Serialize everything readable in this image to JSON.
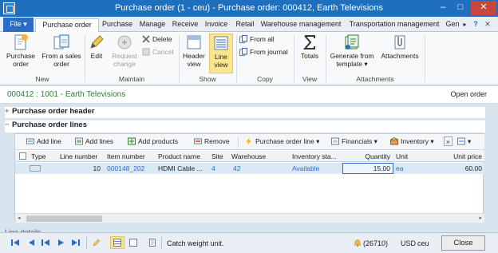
{
  "window": {
    "title": "Purchase order (1 - ceu) - Purchase order: 000412, Earth Televisions",
    "minimize": "–",
    "maximize": "□",
    "close": "✕"
  },
  "tabs": [
    "File",
    "Purchase order",
    "Purchase",
    "Manage",
    "Receive",
    "Invoice",
    "Retail",
    "Warehouse management",
    "Transportation management",
    "Gen",
    "?",
    "✕"
  ],
  "ribbon": {
    "new": {
      "purchase_order": "Purchase order",
      "from_sales_order": "From a sales order",
      "group": "New"
    },
    "maintain": {
      "edit": "Edit",
      "request_change": "Request change",
      "delete": "Delete",
      "cancel": "Cancel",
      "group": "Maintain"
    },
    "show": {
      "header_view": "Header view",
      "line_view": "Line view",
      "group": "Show"
    },
    "copy": {
      "from_all": "From all",
      "from_journal": "From journal",
      "group": "Copy"
    },
    "view": {
      "totals": "Totals",
      "group": "View"
    },
    "attachments": {
      "generate_from_template": "Generate from template",
      "attachments": "Attachments",
      "group": "Attachments"
    }
  },
  "record": {
    "title": "000412 : 1001 - Earth Televisions",
    "open_order": "Open order"
  },
  "sections": {
    "header": "Purchase order header",
    "lines": "Purchase order lines"
  },
  "grid_toolbar": {
    "add_line": "Add line",
    "add_lines": "Add lines",
    "add_products": "Add products",
    "remove": "Remove",
    "purchase_order_line": "Purchase order line",
    "financials": "Financials",
    "inventory": "Inventory",
    "more": "»"
  },
  "grid": {
    "columns": [
      "Type",
      "Line number",
      "Item number",
      "Product name",
      "Site",
      "Warehouse",
      "Inventory sta...",
      "Quantity",
      "Unit",
      "Unit price"
    ],
    "rows": [
      {
        "line_number": "10",
        "item_number": "000148_202",
        "product_name": "HDMI Cable ...",
        "site": "4",
        "warehouse": "42",
        "inventory_status": "Available",
        "quantity": "15.00",
        "unit": "ea",
        "unit_price": "60.00"
      }
    ]
  },
  "lines_details": "Line details",
  "status": {
    "message": "Catch weight unit.",
    "notifications": "(26710)",
    "currency": "USD",
    "company": "ceu",
    "close": "Close"
  }
}
